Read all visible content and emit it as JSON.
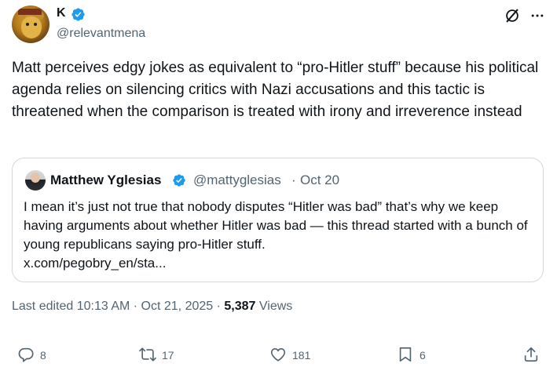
{
  "author": {
    "name": "K",
    "handle": "@relevantmena",
    "verified": true
  },
  "tweet_text": "Matt perceives edgy jokes as equivalent to “pro-Hitler stuff” because his political agenda relies on silencing critics with Nazi accusations and this tactic is threatened when the comparison is treated with irony and irreverence instead",
  "quoted_tweet": {
    "name": "Matthew Yglesias",
    "handle": "@mattyglesias",
    "separator": "·",
    "date": "Oct 20",
    "verified": true,
    "text": "I mean it’s just not true that nobody disputes “Hitler was bad” that’s why we keep having arguments about whether Hitler was bad — this thread started with a bunch of young republicans saying pro-Hitler stuff.",
    "link": "x.com/pegobry_en/sta..."
  },
  "meta": {
    "edited_label": "Last edited 10:13 AM · Oct 21, 2025 · ",
    "views_count": "5,387",
    "views_label": " Views"
  },
  "actions": {
    "reply_count": "8",
    "repost_count": "17",
    "like_count": "181",
    "bookmark_count": "6"
  },
  "colors": {
    "verified_blue": "#1d9bf0",
    "secondary_text": "#536471",
    "border": "#cfd9de"
  },
  "icons": [
    "verified-badge-icon",
    "grok-icon",
    "more-icon",
    "reply-icon",
    "repost-icon",
    "like-icon",
    "bookmark-icon",
    "share-icon"
  ]
}
